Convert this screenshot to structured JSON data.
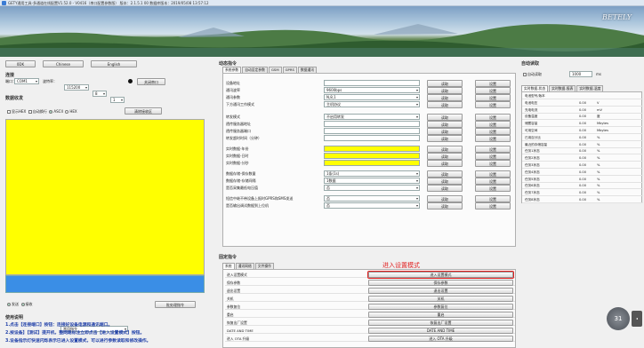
{
  "window": {
    "title": "GETY通用工具-多通道在线配置V1.52.0 - V0416（串口配置参数版） 版本：2.1.5.1 00 数据库版本：2019/05/08 13:57:12"
  },
  "brand": {
    "logo": "BETELY"
  },
  "left": {
    "lang_buttons": [
      "0DK",
      "Chinese",
      "English"
    ],
    "conn_title": "连接",
    "port_label": "端口：",
    "port_value": "COM1",
    "baud_label": "波特率：",
    "baud_value": "115200",
    "data_value": "8",
    "stop_value": "1",
    "close_btn": "关闭串口",
    "recv_title": "数据收发",
    "opt_hex": "显示HEX",
    "opt_autoline": "自动换行",
    "opt_ascii": "ASCII",
    "opt_hex2": "HEX",
    "clear_btn": "清除接收区",
    "send_opt_a": "发送",
    "send_opt_b": "接收",
    "send_select": "常用指令",
    "send_btn": "批处理指令",
    "help_title": "使用说明",
    "help_lines": [
      "1.点击【连接端口】按钮：连接好设备电源和通讯端口。",
      "2.按设备】【测试】提开机，整网路标注立即点击【进入设置模式】按钮。",
      "3.设备指示灯快速闪烁表示已进入设置模式，可以进行参数读取和修改操作。"
    ]
  },
  "dyn": {
    "title": "动态指令",
    "tabs": [
      "系统参数",
      "自动设定参数",
      "GSM",
      "GPRS",
      "数据通讯"
    ],
    "rows": [
      {
        "label": "设备地址",
        "kind": "input",
        "value": ""
      },
      {
        "label": "通讯波率",
        "kind": "select",
        "value": "9600bps"
      },
      {
        "label": "通讯参数",
        "kind": "select",
        "value": "N,8,1"
      },
      {
        "label": "下方通讯工作模式",
        "kind": "select",
        "value": "主机协议"
      },
      {
        "label": "转发模式",
        "kind": "select",
        "value": "不启用转发"
      },
      {
        "label": "透传服务器地址",
        "kind": "input",
        "value": ""
      },
      {
        "label": "透传服务器端口",
        "kind": "input",
        "value": ""
      },
      {
        "label": "转发超时时间（分钟）",
        "kind": "input",
        "value": ""
      },
      {
        "label": "实时数据-年份",
        "kind": "yellow",
        "value": ""
      },
      {
        "label": "实时数据-日时",
        "kind": "yellow",
        "value": ""
      },
      {
        "label": "实时数据-分秒",
        "kind": "yellow",
        "value": ""
      },
      {
        "label": "数据存储-保存数量",
        "kind": "select",
        "value": "1条(1s)"
      },
      {
        "label": "数据存储-存储间隔",
        "kind": "select",
        "value": "1数据"
      },
      {
        "label": "是否采集最低电压值",
        "kind": "select",
        "value": "否"
      },
      {
        "label": "短信中继不带设备上报时GPRS和SMS发送",
        "kind": "select",
        "value": "否"
      },
      {
        "label": "是否输出调试数据到上位机",
        "kind": "select",
        "value": "否"
      }
    ],
    "read_btn": "读取",
    "set_btn": "设置"
  },
  "fixed": {
    "title": "固定指令",
    "tabs": [
      "系统",
      "通讯网络",
      "文件操作"
    ],
    "annotation": "进入设置模式",
    "rows": [
      {
        "label": "进入设置模式",
        "btn": "进入设置模式"
      },
      {
        "label": "保存参数",
        "btn": "保存参数"
      },
      {
        "label": "退出设置",
        "btn": "退出设置"
      },
      {
        "label": "关机",
        "btn": "关机"
      },
      {
        "label": "参数复位",
        "btn": "参数复位"
      },
      {
        "label": "重启",
        "btn": "重启"
      },
      {
        "label": "恢复出厂设置",
        "btn": "恢复出厂设置"
      },
      {
        "label": "DATE AND TIME",
        "btn": "DATE AND TIME"
      },
      {
        "label": "进入 OTA 升级",
        "btn": "进入 OTA 升级"
      }
    ]
  },
  "auto": {
    "title": "自动读取",
    "chk_label": "自动读取",
    "interval": "1000",
    "unit": "ms",
    "tabs": [
      "实时数据-状态",
      "实时数据-报表",
      "实时数据-温度"
    ],
    "rows": [
      {
        "n": "电池型号/版本",
        "v": "",
        "u": ""
      },
      {
        "n": "电池电压",
        "v": "0.00",
        "u": "V"
      },
      {
        "n": "充电电流",
        "v": "0.00",
        "u": "mV"
      },
      {
        "n": "设备温度",
        "v": "0.00",
        "u": "度"
      },
      {
        "n": "储蓄容量",
        "v": "0.00",
        "u": "Mbytes"
      },
      {
        "n": "可用空间",
        "v": "0.00",
        "u": "Mbytes"
      },
      {
        "n": "已用百分比",
        "v": "0.00",
        "u": "%"
      },
      {
        "n": "最近的存储容量",
        "v": "0.00",
        "u": "%"
      },
      {
        "n": "任务1状态",
        "v": "0.00",
        "u": "%"
      },
      {
        "n": "任务2状态",
        "v": "0.00",
        "u": "%"
      },
      {
        "n": "任务3状态",
        "v": "0.00",
        "u": "%"
      },
      {
        "n": "任务4状态",
        "v": "0.00",
        "u": "%"
      },
      {
        "n": "任务5状态",
        "v": "0.00",
        "u": "%"
      },
      {
        "n": "任务6状态",
        "v": "0.00",
        "u": "%"
      },
      {
        "n": "任务7状态",
        "v": "0.00",
        "u": "%"
      },
      {
        "n": "任务8状态",
        "v": "0.00",
        "u": "%"
      }
    ],
    "speed": "31"
  },
  "colors": {
    "highlight": "#ffff00",
    "send_area": "#3a8ee6",
    "annotation": "#e02020",
    "help": "#1f3fa8"
  }
}
